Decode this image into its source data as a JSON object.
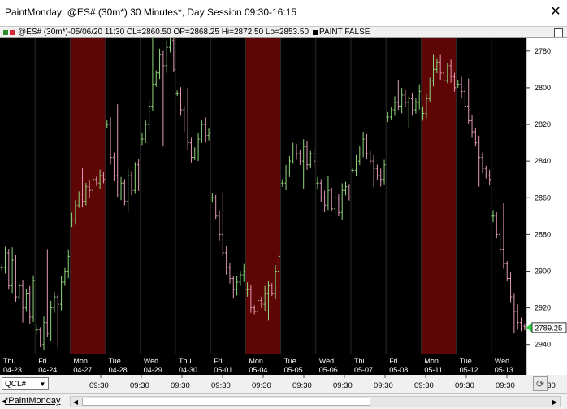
{
  "window": {
    "title": "PaintMonday: @ES# (30m*) 30 Minutes*, Day Session 09:30-16:15",
    "close_glyph": "✕"
  },
  "info_bar": {
    "text": "@ES# (30m*)-05/06/20 11:30 CL=2860.50 OP=2868.25 Hi=2872.50 Lo=2853.50",
    "study_label": "PAINT FALSE"
  },
  "colors": {
    "background": "#000000",
    "up_bar": "#8fd67a",
    "down_bar": "#e29bb4",
    "monday_highlight": "#5e0606",
    "price_marker": "#2ecc40"
  },
  "price_axis": {
    "labels": [
      "2940",
      "2920",
      "2900",
      "2880",
      "2860",
      "2840",
      "2820",
      "2800",
      "2780"
    ],
    "current_price": "2789.25"
  },
  "date_axis": [
    {
      "day": "Thu",
      "date": "04-23",
      "monday": false
    },
    {
      "day": "Fri",
      "date": "04-24",
      "monday": false
    },
    {
      "day": "Mon",
      "date": "04-27",
      "monday": true
    },
    {
      "day": "Tue",
      "date": "04-28",
      "monday": false
    },
    {
      "day": "Wed",
      "date": "04-29",
      "monday": false
    },
    {
      "day": "Thu",
      "date": "04-30",
      "monday": false
    },
    {
      "day": "Fri",
      "date": "05-01",
      "monday": false
    },
    {
      "day": "Mon",
      "date": "05-04",
      "monday": true
    },
    {
      "day": "Tue",
      "date": "05-05",
      "monday": false
    },
    {
      "day": "Wed",
      "date": "05-06",
      "monday": false
    },
    {
      "day": "Thu",
      "date": "05-07",
      "monday": false
    },
    {
      "day": "Fri",
      "date": "05-08",
      "monday": false
    },
    {
      "day": "Mon",
      "date": "05-11",
      "monday": true
    },
    {
      "day": "Tue",
      "date": "05-12",
      "monday": false
    },
    {
      "day": "Wed",
      "date": "05-13",
      "monday": false
    }
  ],
  "time_axis": {
    "labels": [
      "09:30",
      "09:30",
      "09:30",
      "09:30",
      "09:30",
      "09:30",
      "09:30",
      "09:30",
      "09:30",
      "09:30",
      "09:30",
      "09:30"
    ]
  },
  "symbol": {
    "value": "QCL#",
    "dropdown_glyph": "▼"
  },
  "refresh_glyph": "⟳",
  "workspace_tab": "*PaintMonday",
  "scroll": {
    "left_glyph": "◀",
    "right_glyph": "▶",
    "tab_nav_glyph": "◀"
  },
  "chart_data": {
    "type": "bar",
    "title": "@ES# (30m*) 30 Minutes*",
    "ylim": [
      2775,
      2947
    ],
    "y_ticks": [
      2780,
      2800,
      2820,
      2840,
      2860,
      2880,
      2900,
      2920,
      2940
    ],
    "grid": false,
    "highlighted_days": [
      "04-27",
      "05-04",
      "05-11"
    ],
    "last_price": 2789.25,
    "days": [
      {
        "date": "04-23",
        "o": 2822,
        "c": 2815,
        "path": [
          2822,
          2830,
          2812,
          2826,
          2806,
          2812,
          2800,
          2808,
          2795,
          2815
        ],
        "hi": 2833,
        "lo": 2792
      },
      {
        "date": "04-24",
        "o": 2788,
        "c": 2828,
        "path": [
          2788,
          2780,
          2792,
          2786,
          2800,
          2806,
          2802,
          2814,
          2820,
          2828
        ],
        "hi": 2832,
        "lo": 2778
      },
      {
        "date": "04-27",
        "o": 2848,
        "c": 2870,
        "path": [
          2848,
          2856,
          2862,
          2858,
          2866,
          2864,
          2870,
          2868,
          2872,
          2870
        ],
        "hi": 2876,
        "lo": 2844
      },
      {
        "date": "04-28",
        "o": 2900,
        "c": 2867,
        "path": [
          2900,
          2882,
          2872,
          2862,
          2868,
          2858,
          2872,
          2864,
          2878,
          2867
        ],
        "hi": 2911,
        "lo": 2852
      },
      {
        "date": "04-29",
        "o": 2892,
        "c": 2930,
        "path": [
          2892,
          2900,
          2910,
          2922,
          2928,
          2938,
          2932,
          2942,
          2946,
          2930
        ],
        "hi": 2948,
        "lo": 2888
      },
      {
        "date": "04-30",
        "o": 2917,
        "c": 2895,
        "path": [
          2917,
          2908,
          2898,
          2890,
          2882,
          2886,
          2892,
          2900,
          2894,
          2895
        ],
        "hi": 2920,
        "lo": 2880
      },
      {
        "date": "05-01",
        "o": 2860,
        "c": 2820,
        "path": [
          2860,
          2850,
          2840,
          2830,
          2822,
          2816,
          2810,
          2814,
          2818,
          2820
        ],
        "hi": 2863,
        "lo": 2805
      },
      {
        "date": "05-04",
        "o": 2810,
        "c": 2828,
        "path": [
          2810,
          2800,
          2798,
          2804,
          2802,
          2808,
          2812,
          2808,
          2820,
          2828
        ],
        "hi": 2832,
        "lo": 2793
      },
      {
        "date": "05-05",
        "o": 2868,
        "c": 2880,
        "path": [
          2868,
          2874,
          2880,
          2886,
          2884,
          2880,
          2888,
          2878,
          2884,
          2880
        ],
        "hi": 2890,
        "lo": 2865
      },
      {
        "date": "05-06",
        "o": 2868,
        "c": 2860,
        "path": [
          2868,
          2860,
          2856,
          2864,
          2854,
          2860,
          2852,
          2864,
          2866,
          2860
        ],
        "hi": 2872,
        "lo": 2853
      },
      {
        "date": "05-07",
        "o": 2875,
        "c": 2878,
        "path": [
          2875,
          2880,
          2886,
          2892,
          2884,
          2880,
          2876,
          2872,
          2870,
          2878
        ],
        "hi": 2896,
        "lo": 2866
      },
      {
        "date": "05-08",
        "o": 2904,
        "c": 2918,
        "path": [
          2904,
          2908,
          2912,
          2910,
          2916,
          2912,
          2914,
          2908,
          2912,
          2918
        ],
        "hi": 2924,
        "lo": 2898
      },
      {
        "date": "05-11",
        "o": 2906,
        "c": 2920,
        "path": [
          2906,
          2914,
          2924,
          2930,
          2934,
          2928,
          2924,
          2932,
          2926,
          2920
        ],
        "hi": 2938,
        "lo": 2898
      },
      {
        "date": "05-12",
        "o": 2922,
        "c": 2870,
        "path": [
          2922,
          2918,
          2910,
          2902,
          2896,
          2890,
          2882,
          2876,
          2872,
          2870
        ],
        "hi": 2925,
        "lo": 2866
      },
      {
        "date": "05-13",
        "o": 2850,
        "c": 2789.25,
        "path": [
          2850,
          2840,
          2832,
          2824,
          2816,
          2806,
          2798,
          2792,
          2790,
          2789.25
        ],
        "hi": 2857,
        "lo": 2786
      }
    ]
  }
}
